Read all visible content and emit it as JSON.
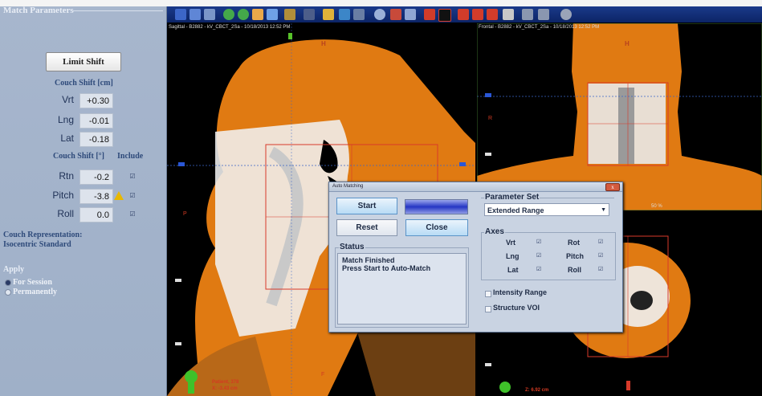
{
  "left_panel": {
    "title": "Match Parameters",
    "limit_shift_button": "Limit Shift",
    "couch_shift_cm_label": "Couch Shift [cm]",
    "translations": [
      {
        "label": "Vrt",
        "value": "+0.30"
      },
      {
        "label": "Lng",
        "value": "-0.01"
      },
      {
        "label": "Lat",
        "value": "-0.18"
      }
    ],
    "couch_shift_deg_label": "Couch Shift [°]",
    "include_label": "Include",
    "rotations": [
      {
        "label": "Rtn",
        "value": "-0.2",
        "include_mark": "☑"
      },
      {
        "label": "Pitch",
        "value": "-3.8",
        "include_mark": "☑"
      },
      {
        "label": "Roll",
        "value": "0.0",
        "include_mark": "☑"
      }
    ],
    "couch_representation_label": "Couch Representation:",
    "couch_representation_value": "Isocentric Standard",
    "apply_label": "Apply",
    "apply_options": [
      "For Session",
      "Permanently"
    ],
    "apply_selected": "For Session"
  },
  "viewer": {
    "sagittal_header": "Sagittal - B2882 - kV_CBCT_2Sa - 10/18/2013 12:52 PM",
    "frontal_header": "Frontal - B2882 - kV_CBCT_2Sa - 10/18/2013 12:52 PM",
    "sagittal_top_marker": "H",
    "frontal_top_marker": "H",
    "left_marker_sag": "P",
    "bottom_marker_sag": "F",
    "left_marker_front": "R",
    "zoom_readout": "50 %",
    "patient_readout_1": "Patient, 378",
    "patient_readout_2": "X: -3.43 cm",
    "z_readout": "Z: 6.92 cm",
    "colors": {
      "tissue": "#e07a12",
      "bone": "#f2f2f2",
      "bg": "#000000",
      "toolbar": "#0c2466"
    }
  },
  "dialog": {
    "title": "Auto Matching",
    "close_glyph": "x",
    "start_button": "Start",
    "reset_button": "Reset",
    "close_button": "Close",
    "status_label": "Status",
    "status_lines": [
      "Match Finished",
      "Press Start to Auto-Match"
    ],
    "parameter_set_label": "Parameter Set",
    "parameter_set_value": "Extended Range",
    "axes_label": "Axes",
    "axes": [
      {
        "label": "Vrt",
        "mark": "☑"
      },
      {
        "label": "Rot",
        "mark": "☑"
      },
      {
        "label": "Lng",
        "mark": "☑"
      },
      {
        "label": "Pitch",
        "mark": "☑"
      },
      {
        "label": "Lat",
        "mark": "☑"
      },
      {
        "label": "Roll",
        "mark": "☑"
      }
    ],
    "intensity_range_label": "Intensity Range",
    "structure_voi_label": "Structure VOI"
  }
}
